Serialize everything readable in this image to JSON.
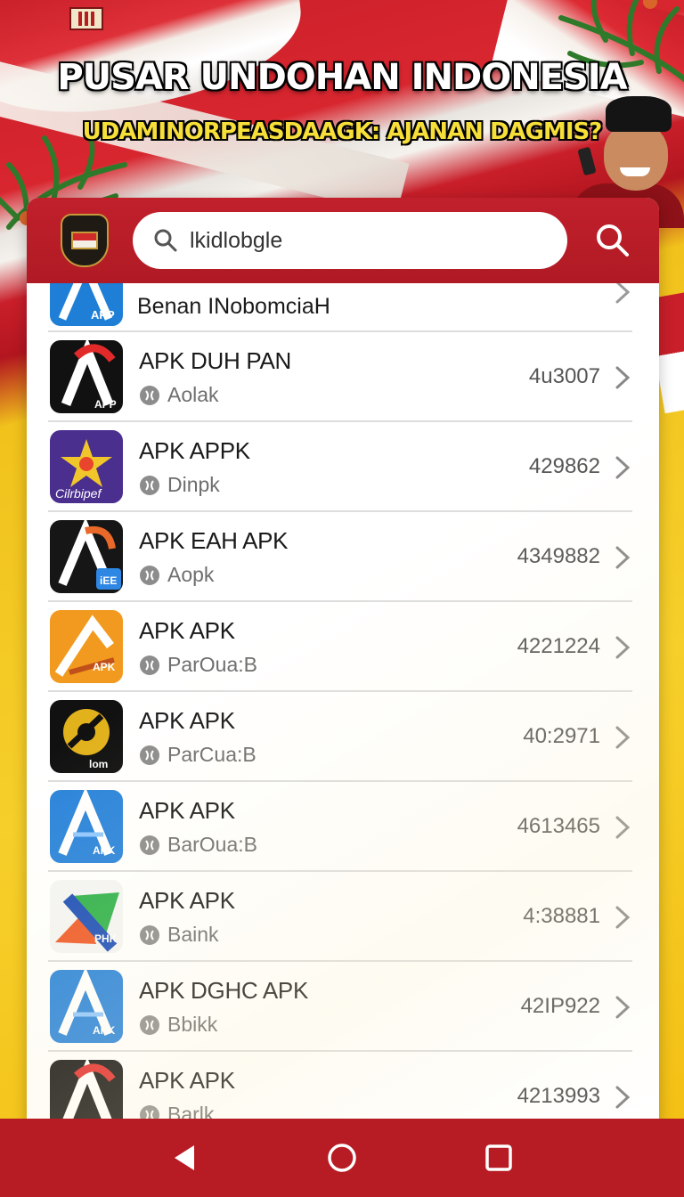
{
  "banner": {
    "headline": "PUSAR UNDOHAN INDONESIA",
    "subline": "UDAMINORPEASDAAGK: AJANAN DAGMIS?"
  },
  "search": {
    "value": "lkidlobgle",
    "icon": "search-icon",
    "button_icon": "search-icon"
  },
  "list": {
    "partial_item": {
      "title": "Benan INobomciaH",
      "icon_label": "APP"
    },
    "items": [
      {
        "title": "APK DUH PAN",
        "sub": "Aolak",
        "count": "4u3007",
        "icon_label": "APP",
        "icon_style": "dark-red"
      },
      {
        "title": "APK APPK",
        "sub": "Dinpk",
        "count": "429862",
        "icon_label": "Cilrbipef",
        "icon_style": "purple-star"
      },
      {
        "title": "APK EAH APK",
        "sub": "Aopk",
        "count": "4349882",
        "icon_label": "iEE",
        "icon_style": "dark-orange"
      },
      {
        "title": "APK APK",
        "sub": "ParOua:B",
        "count": "4221224",
        "icon_label": "APK",
        "icon_style": "orange"
      },
      {
        "title": "APK APK",
        "sub": "ParCua:B",
        "count": "40:2971",
        "icon_label": "lom",
        "icon_style": "black-gold"
      },
      {
        "title": "APK APK",
        "sub": "BarOua:B",
        "count": "4613465",
        "icon_label": "APK",
        "icon_style": "blue"
      },
      {
        "title": "APK APK",
        "sub": "Baink",
        "count": "4:38881",
        "icon_label": "PHK",
        "icon_style": "multicolor"
      },
      {
        "title": "APK DGHC APK",
        "sub": "Bbikk",
        "count": "42IP922",
        "icon_label": "APK",
        "icon_style": "blue"
      },
      {
        "title": "APK APK",
        "sub": "Barlk",
        "count": "4213993",
        "icon_label": "",
        "icon_style": "dark-red"
      }
    ]
  },
  "colors": {
    "primary_red": "#b71c24",
    "yellow": "#f2c419",
    "text_dark": "#1a1a1a",
    "text_muted": "#6e6e6e"
  },
  "navbar": {
    "back_icon": "back-triangle-icon",
    "home_icon": "home-circle-icon",
    "recent_icon": "recent-square-icon"
  }
}
